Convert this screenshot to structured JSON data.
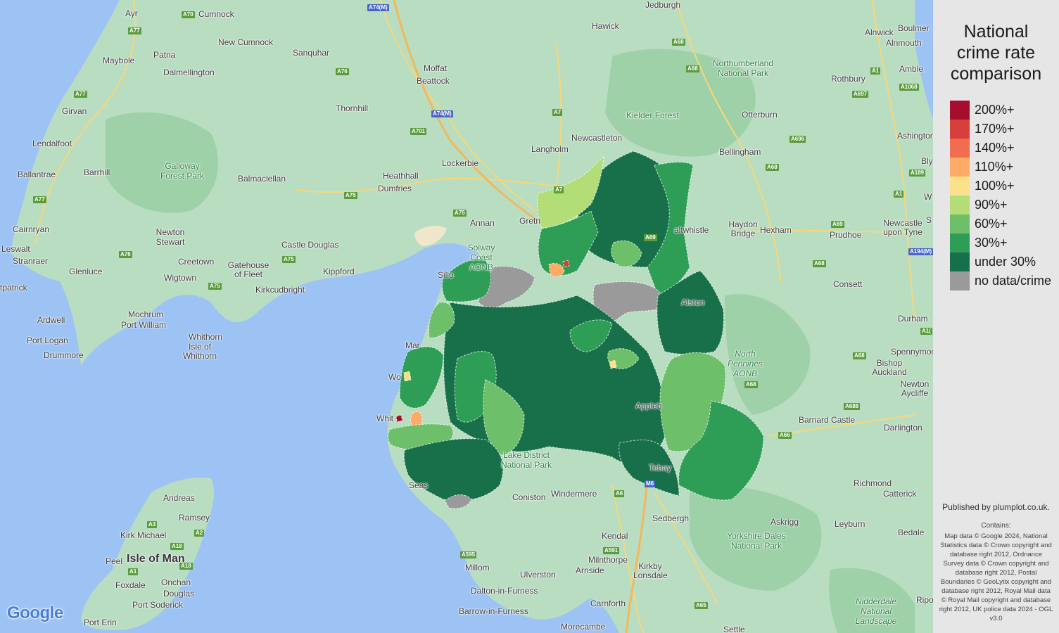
{
  "legend": {
    "title_lines": [
      "National",
      "crime rate",
      "comparison"
    ],
    "items": [
      {
        "label": "200%+",
        "color": "#a50f2d"
      },
      {
        "label": "170%+",
        "color": "#d7403a"
      },
      {
        "label": "140%+",
        "color": "#f26c4f"
      },
      {
        "label": "110%+",
        "color": "#fdab67"
      },
      {
        "label": "100%+",
        "color": "#fde08b"
      },
      {
        "label": "90%+",
        "color": "#b2dd77"
      },
      {
        "label": "60%+",
        "color": "#6ebf6a"
      },
      {
        "label": "30%+",
        "color": "#2e9e57"
      },
      {
        "label": "under 30%",
        "color": "#17704a"
      },
      {
        "label": "no data/crime",
        "color": "#9a9a9a"
      }
    ],
    "published": "Published by plumplot.co.uk.",
    "contains_label": "Contains:",
    "credits": "Map data © Google 2024, National Statistics data © Crown copyright and database right 2012, Ordnance Survey data © Crown copyright and database right 2012, Postal Boundaries © GeoLytix copyright and database right 2012, Royal Mail data © Royal Mail copyright and database right 2012, UK police data 2024 - OGL v3.0"
  },
  "map": {
    "google_logo": "Google",
    "colors": {
      "sea": "#9dc3f5",
      "land": "#b9ddc1",
      "forest": "#9fd1a9",
      "road": "#f6d77a",
      "motorway": "#f3b85b"
    },
    "place_labels": [
      "Ayr",
      "Cumnock",
      "New Cumnock",
      "Sanquhar",
      "Maybole",
      "Patna",
      "Dalmellington",
      "Girvan",
      "Lendalfoot",
      "Ballantrae",
      "Barrhill",
      "Cairnryan",
      "Leswalt",
      "Stranraer",
      "Glenluce",
      "Newton Stewart",
      "Creetown",
      "Wigtown",
      "Gatehouse of Fleet",
      "Kirkcudbright",
      "Castle Douglas",
      "Balmaclellan",
      "Kippford",
      "Ardwell",
      "Port Logan",
      "Drummore",
      "Mochrum",
      "Port William",
      "Whithorn",
      "Isle of Whithorn",
      "tpatrick",
      "Dumfries",
      "Heathhall",
      "Lockerbie",
      "Moffat",
      "Beattock",
      "Thornhill",
      "Annan",
      "Gretn",
      "Hawick",
      "Jedburgh",
      "Langholm",
      "Newcastleton",
      "Bellingham",
      "Otterburn",
      "Rothbury",
      "Alnwick",
      "Alnmouth",
      "Boulmer",
      "Amble",
      "Ashington",
      "Bly",
      "W",
      "Haydon Bridge",
      "Hexham",
      "Prudhoe",
      "Newcastle upon Tyne",
      "S",
      "altwhistle",
      "Consett",
      "Durham",
      "Spennymoo",
      "Bishop Auckland",
      "Newton Aycliffe",
      "Darlington",
      "Barnard Castle",
      "Richmond",
      "Catterick",
      "Askrigg",
      "Leyburn",
      "Bedale",
      "Ripo",
      "Sedbergh",
      "Kendal",
      "Windermere",
      "Coniston",
      "Milnthorpe",
      "Arnside",
      "Kirkby Lonsdale",
      "Ulverston",
      "Millom",
      "Dalton-in-Furness",
      "Barrow-in-Furness",
      "Carnforth",
      "Morecambe",
      "Settle",
      "Seas",
      "Whit",
      "Wo",
      "Mar",
      "Sillo",
      "Alston",
      "Appleb",
      "Tebay",
      "Andreas",
      "Ramsey",
      "Kirk Michael",
      "Peel",
      "Isle of Man",
      "Foxdale",
      "Onchan",
      "Douglas",
      "Port Soderick",
      "Port Erin"
    ],
    "park_labels": [
      "Galloway Forest Park",
      "Northumberland National Park",
      "Kielder Forest",
      "North Pennines AONB",
      "Lake District National Park",
      "Yorkshire Dales National Park",
      "Nidderdale National Landscape",
      "Solway Coast AONB"
    ],
    "road_labels": [
      "A70",
      "A77",
      "A77",
      "A77",
      "A74(M)",
      "A76",
      "A76",
      "A701",
      "A75",
      "A75",
      "A75",
      "A75",
      "A74(M)",
      "A7",
      "A7",
      "A68",
      "A68",
      "A68",
      "A68",
      "A1",
      "A697",
      "A1068",
      "A696",
      "A189",
      "A1",
      "A69",
      "A69",
      "A68",
      "A1(",
      "A194(M)",
      "A68",
      "A688",
      "A66",
      "A6",
      "A591",
      "A595",
      "A65",
      "M6",
      "A3",
      "A2",
      "A18",
      "A1",
      "A18"
    ],
    "regions": [
      {
        "id": "carlisle-north-east",
        "band": "under 30%"
      },
      {
        "id": "carlisle-city",
        "band": "30%+"
      },
      {
        "id": "carlisle-centre",
        "band": "110%+"
      },
      {
        "id": "carlisle-centre-hotspot",
        "band": "170%+"
      },
      {
        "id": "longtown-north",
        "band": "90%+"
      },
      {
        "id": "brampton-east",
        "band": "30%+"
      },
      {
        "id": "brampton",
        "band": "60%+"
      },
      {
        "id": "wigton",
        "band": "no data/crime"
      },
      {
        "id": "dalston",
        "band": "no data/crime"
      },
      {
        "id": "alston-moor",
        "band": "under 30%"
      },
      {
        "id": "penrith-north",
        "band": "30%+"
      },
      {
        "id": "penrith",
        "band": "60%+"
      },
      {
        "id": "penrith-centre",
        "band": "100%+"
      },
      {
        "id": "appleby",
        "band": "60%+"
      },
      {
        "id": "kirkby-stephen",
        "band": "30%+"
      },
      {
        "id": "shap",
        "band": "under 30%"
      },
      {
        "id": "keswick-central",
        "band": "under 30%"
      },
      {
        "id": "cockermouth",
        "band": "30%+"
      },
      {
        "id": "maryport",
        "band": "60%+"
      },
      {
        "id": "workington-coast",
        "band": "30%+"
      },
      {
        "id": "workington-centre",
        "band": "100%+"
      },
      {
        "id": "whitehaven",
        "band": "110%+"
      },
      {
        "id": "whitehaven-hotspot",
        "band": "200%+"
      },
      {
        "id": "egremont",
        "band": "60%+"
      },
      {
        "id": "borrowdale",
        "band": "60%+"
      },
      {
        "id": "seascale",
        "band": "under 30%"
      },
      {
        "id": "bootle",
        "band": "no data/crime"
      },
      {
        "id": "aspatria",
        "band": "30%+"
      }
    ]
  }
}
